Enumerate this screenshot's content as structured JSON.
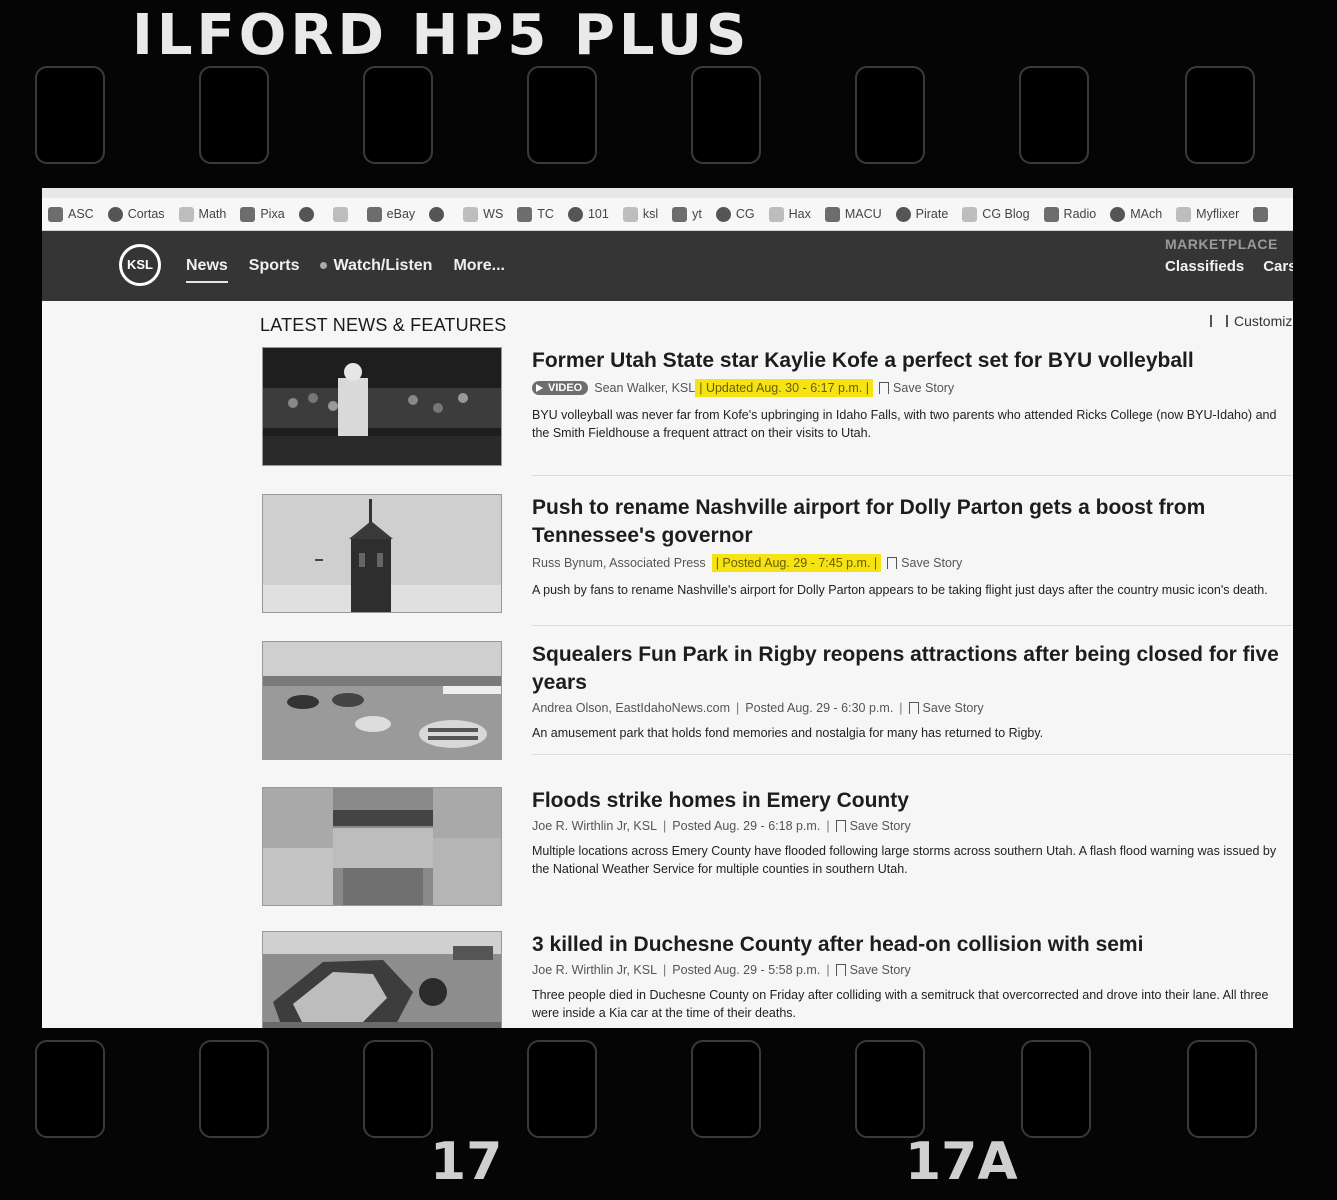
{
  "film": {
    "title": "ILFORD HP5 PLUS",
    "frame_left": "17",
    "frame_right": "17A"
  },
  "bookmarks": [
    {
      "icon": "asc-icon",
      "label": "ASC"
    },
    {
      "icon": "cortas-icon",
      "label": "Cortas"
    },
    {
      "icon": "graduation-cap-icon",
      "label": "Math"
    },
    {
      "icon": "pixabay-icon",
      "label": "Pixa"
    },
    {
      "icon": "facebook-icon",
      "label": ""
    },
    {
      "icon": "yahoo-icon",
      "label": ""
    },
    {
      "icon": "ebay-bag-icon",
      "label": "eBay"
    },
    {
      "icon": "google-icon",
      "label": ""
    },
    {
      "icon": "ws-icon",
      "label": "WS"
    },
    {
      "icon": "tc-icon",
      "label": "TC"
    },
    {
      "icon": "101-icon",
      "label": "101"
    },
    {
      "icon": "ksl-icon",
      "label": "ksl"
    },
    {
      "icon": "youtube-icon",
      "label": "yt"
    },
    {
      "icon": "cg-icon",
      "label": "CG"
    },
    {
      "icon": "hax-icon",
      "label": "Hax"
    },
    {
      "icon": "macu-icon",
      "label": "MACU"
    },
    {
      "icon": "pirate-icon",
      "label": "Pirate"
    },
    {
      "icon": "cg-blog-icon",
      "label": "CG Blog"
    },
    {
      "icon": "radio-icon",
      "label": "Radio"
    },
    {
      "icon": "mach-icon",
      "label": "MAch"
    },
    {
      "icon": "myflixer-icon",
      "label": "Myflixer"
    },
    {
      "icon": "extension-icon",
      "label": ""
    }
  ],
  "nav": {
    "logo": "KSL",
    "items": [
      "News",
      "Sports",
      "Watch/Listen",
      "More..."
    ],
    "marketplace_label": "MARKETPLACE",
    "marketplace_links": [
      "Classifieds",
      "Cars"
    ]
  },
  "main": {
    "section_title": "LATEST NEWS & FEATURES",
    "customize": "Customiz"
  },
  "articles": [
    {
      "headline": "Former Utah State star Kaylie Kofe a perfect set for BYU volleyball",
      "badge": "VIDEO",
      "author": "Sean Walker, KSL",
      "date": "Updated Aug. 30 - 6:17 p.m.",
      "highlighted": true,
      "save": "Save Story",
      "summary": "BYU volleyball was never far from Kofe's upbringing in Idaho Falls, with two parents who attended Ricks College (now BYU-Idaho) and the Smith Fieldhouse a frequent attract on their visits to Utah."
    },
    {
      "headline": "Push to rename Nashville airport for Dolly Parton gets a boost from Tennessee's governor",
      "badge": "",
      "author": "Russ Bynum, Associated Press",
      "date": "Posted Aug. 29 - 7:45 p.m.",
      "highlighted": true,
      "save": "Save Story",
      "summary": "A push by fans to rename Nashville's airport for Dolly Parton appears to be taking flight just days after the country music icon's death."
    },
    {
      "headline": "Squealers Fun Park in Rigby reopens attractions after being closed for five years",
      "badge": "",
      "author": "Andrea Olson, EastIdahoNews.com",
      "date": "Posted Aug. 29 - 6:30 p.m.",
      "highlighted": false,
      "save": "Save Story",
      "summary": "An amusement park that holds fond memories and nostalgia for many has returned to Rigby."
    },
    {
      "headline": "Floods strike homes in Emery County",
      "badge": "",
      "author": "Joe R. Wirthlin Jr, KSL",
      "date": "Posted Aug. 29 - 6:18 p.m.",
      "highlighted": false,
      "save": "Save Story",
      "summary": "Multiple locations across Emery County have flooded following large storms across southern Utah. A flash flood warning was issued by the National Weather Service for multiple counties in southern Utah."
    },
    {
      "headline": "3 killed in Duchesne County after head-on collision with semi",
      "badge": "",
      "author": "Joe R. Wirthlin Jr, KSL",
      "date": "Posted Aug. 29 - 5:58 p.m.",
      "highlighted": false,
      "save": "Save Story",
      "summary": "Three people died in Duchesne County on Friday after colliding with a semitruck that overcorrected and drove into their lane. All three were inside a Kia car at the time of their deaths."
    }
  ]
}
